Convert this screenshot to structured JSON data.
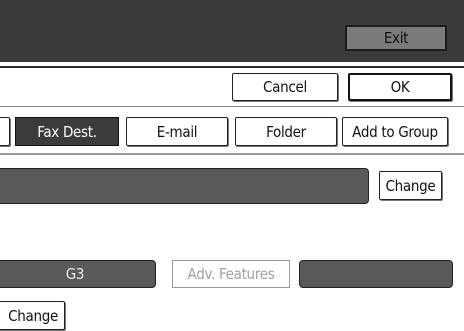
{
  "header": {
    "exit_label": "Exit"
  },
  "actions": {
    "cancel_label": "Cancel",
    "ok_label": "OK"
  },
  "tabs": {
    "fax_dest": "Fax Dest.",
    "email": "E-mail",
    "folder": "Folder",
    "add_to_group": "Add to Group"
  },
  "fields": {
    "change_label": "Change"
  },
  "fax": {
    "line_type": "G3",
    "adv_features_label": "Adv. Features"
  },
  "bottom": {
    "change_label": "Change"
  }
}
